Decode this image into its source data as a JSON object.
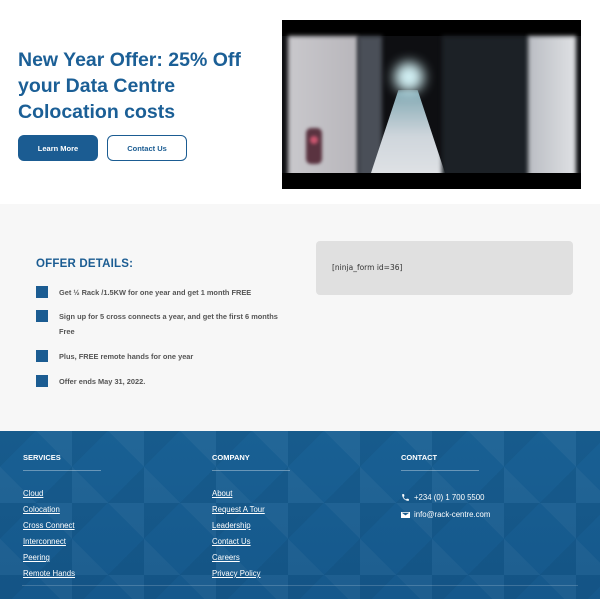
{
  "hero": {
    "title": "New Year Offer: 25% Off your Data Centre Colocation costs",
    "learn_more_label": "Learn More",
    "contact_us_label": "Contact Us"
  },
  "offer": {
    "heading": "OFFER DETAILS:",
    "items": [
      "Get ½ Rack /1.5KW for one year and get 1 month FREE",
      "Sign up for 5 cross connects a year, and get the first 6 months Free",
      "Plus, FREE remote hands for one year",
      "Offer ends May 31, 2022."
    ],
    "form_shortcode": "[ninja_form id=36]"
  },
  "footer": {
    "services": {
      "heading": "SERVICES",
      "links": [
        "Cloud",
        "Colocation",
        "Cross Connect",
        "Interconnect",
        "Peering",
        "Remote Hands"
      ]
    },
    "company": {
      "heading": "COMPANY",
      "links": [
        "About",
        "Request A Tour",
        "Leadership",
        "Contact Us",
        "Careers",
        "Privacy Policy"
      ]
    },
    "contact": {
      "heading": "CONTACT",
      "phone": "+234 (0) 1 700 5500",
      "email": "info@rack-centre.com",
      "phone_icon": "phone-icon",
      "email_icon": "envelope-icon"
    }
  },
  "colors": {
    "brand_blue": "#1b5c92",
    "footer_blue": "#1a6498",
    "offer_bg": "#f7f7f7",
    "form_bg": "#e0e0e0"
  }
}
